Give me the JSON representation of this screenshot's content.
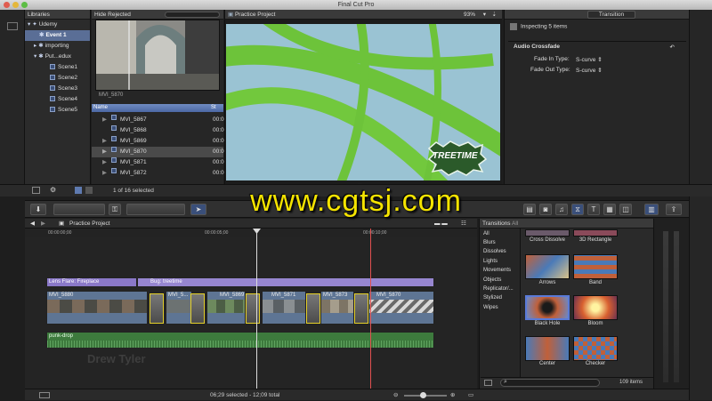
{
  "window": {
    "title": "Final Cut Pro"
  },
  "libraries": {
    "header": "Libraries",
    "items": [
      {
        "label": "Udemy",
        "level": 0
      },
      {
        "label": "Event 1",
        "level": 1,
        "selected": true
      },
      {
        "label": "importing",
        "level": 1
      },
      {
        "label": "Put...edux",
        "level": 1
      },
      {
        "label": "Scene1",
        "level": 2
      },
      {
        "label": "Scene2",
        "level": 2
      },
      {
        "label": "Scene3",
        "level": 2
      },
      {
        "label": "Scene4",
        "level": 2
      },
      {
        "label": "Scene5",
        "level": 2
      }
    ]
  },
  "browser": {
    "filter": "Hide Rejected",
    "thumb_caption": "MVI_5870",
    "col_name": "Name",
    "col_start": "St",
    "rows": [
      {
        "name": "MVI_5867",
        "start": "00:0"
      },
      {
        "name": "MVI_5868",
        "start": "00:0"
      },
      {
        "name": "MVI_5869",
        "start": "00:0"
      },
      {
        "name": "MVI_5870",
        "start": "00:0",
        "selected": true
      },
      {
        "name": "MVI_5871",
        "start": "00:0"
      },
      {
        "name": "MVI_5872",
        "start": "00:0"
      }
    ],
    "count": "1 of 16 selected"
  },
  "viewer": {
    "title": "Practice Project",
    "zoom": "93%",
    "overlay_logo": "TREETIME"
  },
  "inspector": {
    "tab": "Transition",
    "header": "Inspecting 5 items",
    "section": "Audio Crossfade",
    "fade_in_label": "Fade In Type:",
    "fade_in_value": "S-curve",
    "fade_out_label": "Fade Out Type:",
    "fade_out_value": "S-curve"
  },
  "timeline": {
    "project": "Practice Project",
    "ruler": [
      "00:00:00;00",
      "00:00:05;00",
      "00:00:10;00"
    ],
    "title_clips": [
      "Lens Flare: Fireplace",
      "Bug: treetime"
    ],
    "video_clips": [
      "MVI_5880",
      "MVI_5...",
      "MVI_5869",
      "MVI_5871",
      "MVI_5873",
      "MVI_5870"
    ],
    "audio_clip": "punk-drop",
    "watermark_name": "Drew Tyler"
  },
  "transitions": {
    "header": "Transitions",
    "filter": "All",
    "categories": [
      "All",
      "Blurs",
      "Dissolves",
      "Lights",
      "Movements",
      "Objects",
      "Replicator/...",
      "Stylized",
      "Wipes"
    ],
    "items": [
      {
        "label": "Cross Dissolve"
      },
      {
        "label": "3D Rectangle"
      },
      {
        "label": "Arrows"
      },
      {
        "label": "Band"
      },
      {
        "label": "Black Hole"
      },
      {
        "label": "Bloom"
      },
      {
        "label": "Center"
      },
      {
        "label": "Checker"
      }
    ],
    "count": "109 items"
  },
  "status": {
    "selection": "06;29 selected - 12;09 total"
  },
  "overlay": {
    "watermark": "www.cgtsj.com"
  },
  "colors": {
    "accent": "#5a6e96",
    "title_clip": "#8a78c8",
    "video_clip": "#5e7594",
    "audio_clip": "#3d7a3d",
    "transition_border": "#e5d12a",
    "playhead": "#e05050"
  }
}
